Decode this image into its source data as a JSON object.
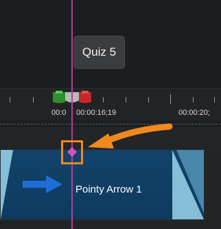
{
  "quiz_marker": {
    "label": "Quiz 5"
  },
  "ruler": {
    "labels": [
      "00:0",
      "00:00:16;19",
      "00:00:20;"
    ]
  },
  "clip": {
    "label": "Pointy Arrow 1"
  },
  "colors": {
    "clip": "#12436a",
    "playhead": "#b3409e",
    "marker": "#d54fc2",
    "callout": "#f08a1e",
    "arrow": "#1f6ed8"
  }
}
